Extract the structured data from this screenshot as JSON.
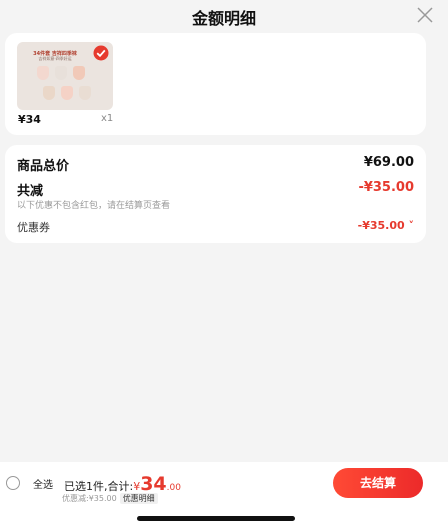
{
  "header": {
    "title": "金额明细",
    "close_icon": "close-icon"
  },
  "product": {
    "thumb_caption": "34件套 吉祥四季袜",
    "thumb_sub": "吉祥如意·四季好运",
    "price": "¥34",
    "quantity": "x1",
    "selected": true
  },
  "summary": {
    "total_label": "商品总价",
    "total_value": "¥69.00",
    "reduce_label": "共减",
    "reduce_value": "-¥35.00",
    "note": "以下优惠不包含红包，请在结算页查看",
    "coupon_label": "优惠券",
    "coupon_value": "-¥35.00 ˅"
  },
  "bottom": {
    "select_all": "全选",
    "selected_prefix": "已选1件,合计:",
    "currency": "¥",
    "total_int": "34",
    "total_dec": ".00",
    "saved_text": "优惠减:¥35.00",
    "detail_link": "优惠明细",
    "checkout": "去结算"
  },
  "colors": {
    "accent": "#e63a2e",
    "background": "#f4f4f4",
    "card": "#ffffff"
  }
}
